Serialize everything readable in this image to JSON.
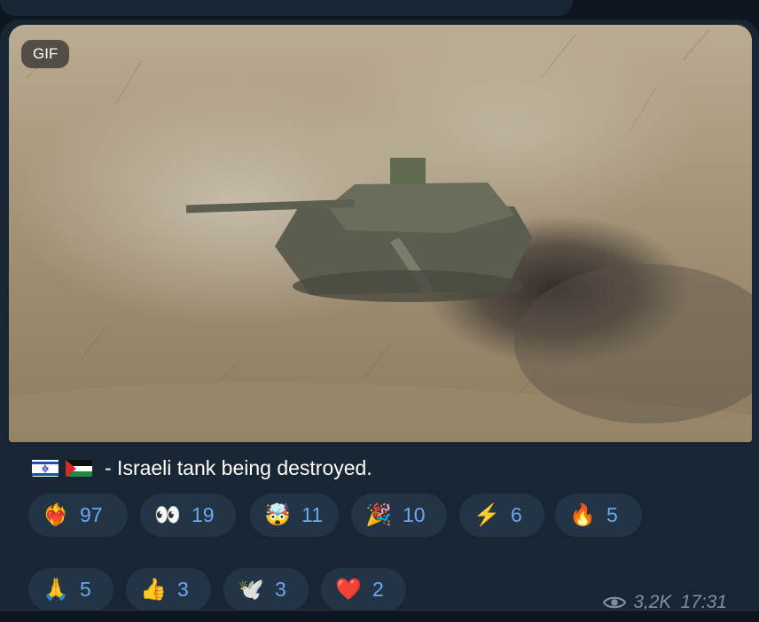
{
  "media": {
    "badge_label": "GIF",
    "description_icon": "tank-video-thumbnail"
  },
  "caption": {
    "flags": [
      "israel-flag",
      "palestine-flag"
    ],
    "text": "- Israeli tank being destroyed."
  },
  "reactions": [
    {
      "emoji": "❤️‍🔥",
      "icon": "heart-on-fire-icon",
      "count": "97"
    },
    {
      "emoji": "👀",
      "icon": "eyes-icon",
      "count": "19"
    },
    {
      "emoji": "🤯",
      "icon": "exploding-head-icon",
      "count": "11"
    },
    {
      "emoji": "🎉",
      "icon": "party-popper-icon",
      "count": "10"
    },
    {
      "emoji": "⚡",
      "icon": "lightning-icon",
      "count": "6"
    },
    {
      "emoji": "🔥",
      "icon": "fire-icon",
      "count": "5"
    },
    {
      "emoji": "🙏",
      "icon": "folded-hands-icon",
      "count": "5"
    },
    {
      "emoji": "👍",
      "icon": "thumbs-up-icon",
      "count": "3"
    },
    {
      "emoji": "🕊️",
      "icon": "dove-icon",
      "count": "3"
    },
    {
      "emoji": "❤️",
      "icon": "red-heart-icon",
      "count": "2"
    }
  ],
  "meta": {
    "views": "3,2K",
    "time": "17:31"
  },
  "colors": {
    "background": "#0e1621",
    "bubble": "#182533",
    "reaction_bg": "#233447",
    "reaction_text": "#6aa9ec",
    "meta_text": "#7e8f9f"
  }
}
